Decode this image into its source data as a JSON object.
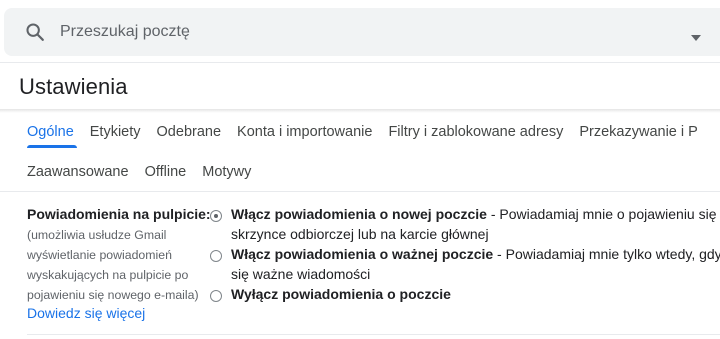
{
  "search": {
    "placeholder": "Przeszukaj pocztę",
    "search_icon": "search-icon",
    "options_icon": "chevron-down-icon"
  },
  "page": {
    "title": "Ustawienia"
  },
  "tabs": {
    "row1": [
      {
        "label": "Ogólne",
        "active": true
      },
      {
        "label": "Etykiety",
        "active": false
      },
      {
        "label": "Odebrane",
        "active": false
      },
      {
        "label": "Konta i importowanie",
        "active": false
      },
      {
        "label": "Filtry i zablokowane adresy",
        "active": false
      },
      {
        "label": "Przekazywanie i P",
        "active": false
      }
    ],
    "row2": [
      {
        "label": "Zaawansowane",
        "active": false
      },
      {
        "label": "Offline",
        "active": false
      },
      {
        "label": "Motywy",
        "active": false
      }
    ]
  },
  "setting": {
    "label": "Powiadomienia na pulpicie:",
    "description_lines": [
      "(umożliwia usłudze Gmail",
      "wyświetlanie powiadomień",
      "wyskakujących na pulpicie po",
      "pojawieniu się nowego e-maila)"
    ],
    "learn_more": "Dowiedz się więcej",
    "options": [
      {
        "title": "Włącz powiadomienia o nowej poczcie",
        "description_line1": " - Powiadamiaj mnie o pojawieniu się",
        "description_line2": "skrzynce odbiorczej lub na karcie głównej",
        "checked": true
      },
      {
        "title": "Włącz powiadomienia o ważnej poczcie",
        "description_line1": " - Powiadamiaj mnie tylko wtedy, gdy",
        "description_line2": "się ważne wiadomości",
        "checked": false
      },
      {
        "title": "Wyłącz powiadomienia o poczcie",
        "checked": false
      }
    ]
  },
  "colors": {
    "accent": "#1a73e8",
    "search_bg": "#f1f3f4",
    "text": "#202124",
    "muted": "#5f6368"
  }
}
